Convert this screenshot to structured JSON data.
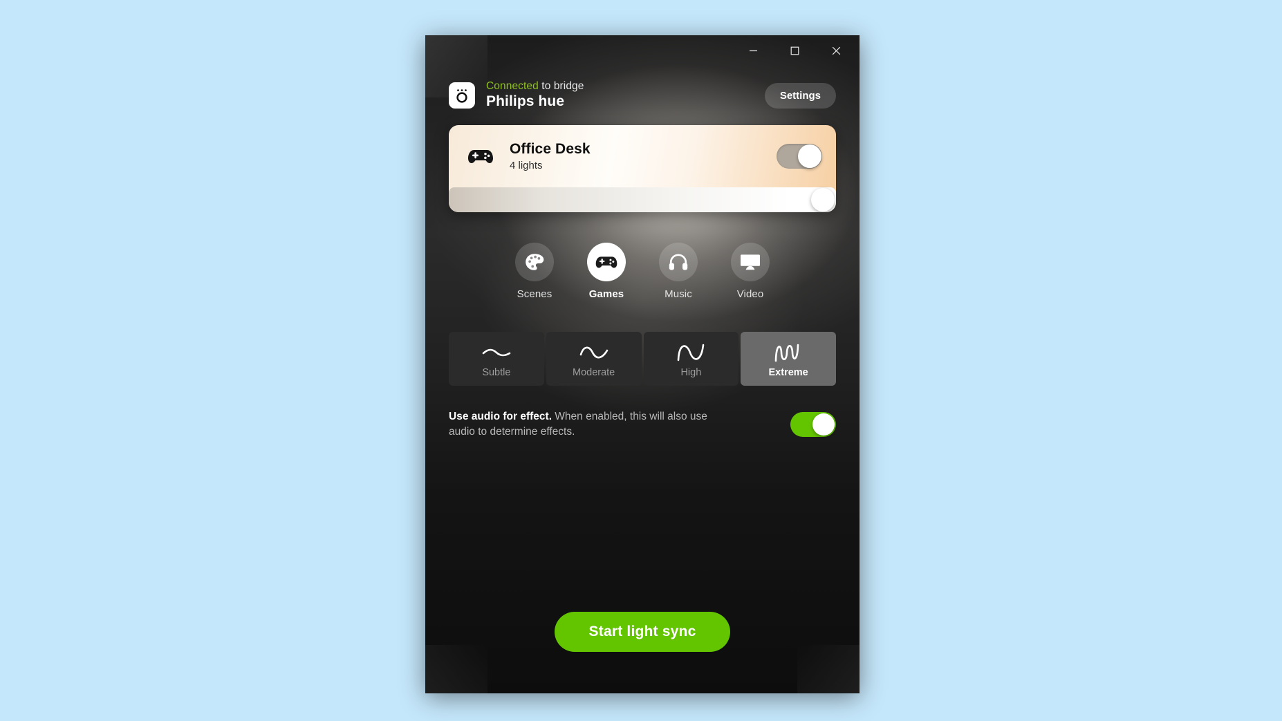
{
  "window": {
    "controls": {
      "minimize_label": "Minimize",
      "maximize_label": "Maximize",
      "close_label": "Close"
    }
  },
  "header": {
    "bridge_icon": "hue-bridge-icon",
    "connection_status": "Connected",
    "connection_suffix": " to bridge",
    "bridge_name": "Philips hue",
    "settings_label": "Settings",
    "status_color": "#8fc31f"
  },
  "light_card": {
    "area_icon": "gamepad-icon",
    "area_name": "Office Desk",
    "area_subtitle": "4 lights",
    "power_on": true,
    "brightness_percent": 100
  },
  "modes": {
    "items": [
      {
        "id": "scenes",
        "label": "Scenes",
        "icon": "palette-icon",
        "selected": false
      },
      {
        "id": "games",
        "label": "Games",
        "icon": "gamepad-icon",
        "selected": true
      },
      {
        "id": "music",
        "label": "Music",
        "icon": "headphones-icon",
        "selected": false
      },
      {
        "id": "video",
        "label": "Video",
        "icon": "monitor-icon",
        "selected": false
      }
    ]
  },
  "intensity": {
    "items": [
      {
        "id": "subtle",
        "label": "Subtle",
        "icon": "wave-flat-icon",
        "selected": false
      },
      {
        "id": "moderate",
        "label": "Moderate",
        "icon": "wave-low-icon",
        "selected": false
      },
      {
        "id": "high",
        "label": "High",
        "icon": "wave-medium-icon",
        "selected": false
      },
      {
        "id": "extreme",
        "label": "Extreme",
        "icon": "wave-high-icon",
        "selected": true
      }
    ]
  },
  "audio_option": {
    "title": "Use audio for effect.",
    "description": " When enabled, this will also use audio to determine effects.",
    "enabled": true,
    "accent_color": "#63c400"
  },
  "footer": {
    "start_sync_label": "Start light sync",
    "accent_color": "#63c400"
  }
}
